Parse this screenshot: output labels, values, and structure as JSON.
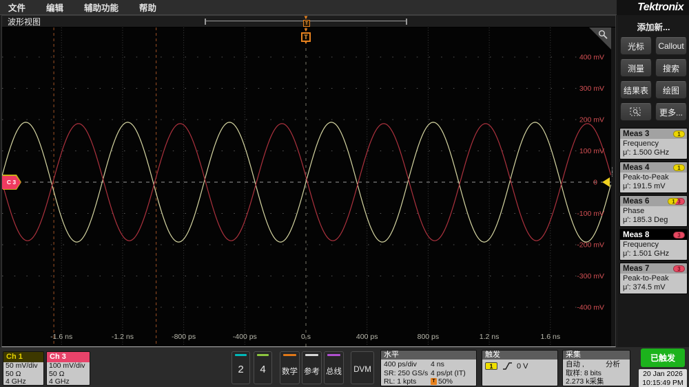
{
  "brand": "Tektronix",
  "menu": {
    "items": [
      "文件",
      "编辑",
      "辅助功能",
      "帮助"
    ]
  },
  "waveform_view": {
    "tab_label": "波形视图",
    "trigger_marker": "T",
    "channel_marker": "C 3"
  },
  "chart_data": {
    "type": "line",
    "title": "Oscilloscope graticule: two ~1.5 GHz sine waves, roughly antiphase",
    "x_axis": {
      "unit": "s",
      "seconds_per_div": 4e-10,
      "divisions": 10,
      "ticks": [
        {
          "t": -1.6e-09,
          "label": "-1.6 ns"
        },
        {
          "t": -1.2e-09,
          "label": "-1.2 ns"
        },
        {
          "t": -8e-10,
          "label": "-800 ps"
        },
        {
          "t": -4e-10,
          "label": "-400 ps"
        },
        {
          "t": 0,
          "label": "0 s"
        },
        {
          "t": 4e-10,
          "label": "400 ps"
        },
        {
          "t": 8e-10,
          "label": "800 ps"
        },
        {
          "t": 1.2e-09,
          "label": "1.2 ns"
        },
        {
          "t": 1.6e-09,
          "label": "1.6 ns"
        }
      ],
      "label_color": "#b9b9ad"
    },
    "y_axis": {
      "unit": "mV",
      "mV_per_div": 100,
      "ticks": [
        {
          "mv": 400,
          "label": "400 mV"
        },
        {
          "mv": 300,
          "label": "300 mV"
        },
        {
          "mv": 200,
          "label": "200 mV"
        },
        {
          "mv": 100,
          "label": "100 mV"
        },
        {
          "mv": 0,
          "label": "0"
        },
        {
          "mv": -100,
          "label": "-100 mV"
        },
        {
          "mv": -200,
          "label": "-200 mV"
        },
        {
          "mv": -300,
          "label": "-300 mV"
        },
        {
          "mv": -400,
          "label": "-400 mV"
        }
      ],
      "label_color": "#d24e52"
    },
    "series": [
      {
        "name": "Ch 1",
        "waveform": "sine",
        "color": "#d6d6a2",
        "frequency_hz": 1500000000.0,
        "peak_to_peak_mV": 191.5,
        "volts_per_div_mV": 50,
        "phase_deg": 0
      },
      {
        "name": "Ch 3",
        "waveform": "sine",
        "color": "#ad323e",
        "frequency_hz": 1501000000.0,
        "peak_to_peak_mV": 374.5,
        "volts_per_div_mV": 100,
        "phase_deg": 185.3
      }
    ],
    "gate_lines_s": [
      -1.65e-09,
      -9.8e-10
    ],
    "gate_line_color": "#b05a28",
    "grid": "dotted",
    "background": "#040404"
  },
  "sidebar": {
    "add_new_label": "添加新...",
    "buttons": [
      {
        "label": "光标"
      },
      {
        "label": "Callout"
      },
      {
        "label": "测量"
      },
      {
        "label": "搜索"
      },
      {
        "label": "结果表"
      },
      {
        "label": "绘图"
      },
      {
        "label": null,
        "icon": "capture-zoom-icon"
      },
      {
        "label": "更多..."
      }
    ],
    "badge_colors": {
      "1": {
        "bg": "#ecd600",
        "fg": "#403800"
      },
      "3": {
        "bg": "#e84962",
        "fg": "#6e0e1e"
      }
    },
    "measurements": [
      {
        "name": "Meas 3",
        "badges": [
          "1"
        ],
        "type": "Frequency",
        "value": "μ': 1.500 GHz",
        "selected": false
      },
      {
        "name": "Meas 4",
        "badges": [
          "1"
        ],
        "type": "Peak-to-Peak",
        "value": "μ': 191.5 mV",
        "selected": false
      },
      {
        "name": "Meas 6",
        "badges": [
          "1",
          "3"
        ],
        "type": "Phase",
        "value": "μ': 185.3 Deg",
        "selected": false
      },
      {
        "name": "Meas 8",
        "badges": [
          "3"
        ],
        "type": "Frequency",
        "value": "μ': 1.501 GHz",
        "selected": true
      },
      {
        "name": "Meas 7",
        "badges": [
          "3"
        ],
        "type": "Peak-to-Peak",
        "value": "μ': 374.5 mV",
        "selected": false
      }
    ]
  },
  "bottom": {
    "channels": [
      {
        "name": "Ch 1",
        "header_bg": "#3d3800",
        "header_fg": "#e8d400",
        "lines": [
          "50 mV/div",
          "50 Ω",
          "4 GHz"
        ]
      },
      {
        "name": "Ch 3",
        "header_bg": "#e8436a",
        "header_fg": "#ffffff",
        "lines": [
          "100 mV/div",
          "50 Ω",
          "4 GHz"
        ]
      }
    ],
    "channel_buttons": [
      {
        "label": "2",
        "accent": "#00b8b8"
      },
      {
        "label": "4",
        "accent": "#8cc63f"
      },
      {
        "label": "数学",
        "accent": "#e07818"
      },
      {
        "label": "参考",
        "accent": "#d8d8d8"
      },
      {
        "label": "总线",
        "accent": "#b050d0"
      },
      {
        "label": "DVM",
        "accent": null
      }
    ],
    "horizontal": {
      "title": "水平",
      "rows": [
        [
          "400 ps/div",
          "4 ns"
        ],
        [
          "SR: 250 GS/s",
          "4 ps/pt (IT)"
        ],
        [
          "RL: 1 kpts",
          "50%"
        ]
      ]
    },
    "trigger": {
      "title": "触发",
      "source": "1",
      "level": "0 V"
    },
    "acquisition": {
      "title": "采集",
      "mode": "自动 ,",
      "analysis": "分析",
      "sample": "取样: 8 bits",
      "count": "2.273 k采集"
    },
    "status": {
      "triggered_label": "已触发",
      "date": "20 Jan 2026",
      "time": "10:15:49 PM"
    }
  }
}
